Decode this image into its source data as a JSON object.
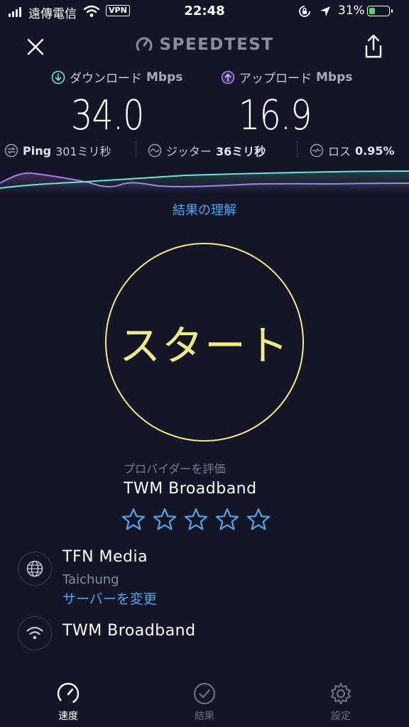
{
  "status_bar": {
    "carrier": "遠傳電信",
    "vpn": "VPN",
    "time": "22:48",
    "battery_percent": "31%",
    "battery_level": 0.31
  },
  "header": {
    "brand": "SPEEDTEST"
  },
  "speeds": {
    "download_label": "ダウンロード",
    "download_unit": "Mbps",
    "download_value": "34.0",
    "upload_label": "アップロード",
    "upload_unit": "Mbps",
    "upload_value": "16.9"
  },
  "metrics": {
    "ping_label": "Ping",
    "ping_value": "301ミリ秒",
    "jitter_label": "ジッター",
    "jitter_value": "36ミリ秒",
    "loss_label": "ロス",
    "loss_value": "0.95%"
  },
  "understand_link": "結果の理解",
  "start_label": "スタート",
  "rating": {
    "prompt": "プロバイダーを評価",
    "provider": "TWM Broadband",
    "stars_total": 5,
    "stars_filled": 0
  },
  "server": {
    "name": "TFN Media",
    "city": "Taichung",
    "change_label": "サーバーを変更"
  },
  "isp": {
    "name": "TWM Broadband"
  },
  "tabs": {
    "speed": "速度",
    "results": "結果",
    "settings": "設定"
  },
  "colors": {
    "background": "#141526",
    "download_accent": "#6fe3d2",
    "upload_accent": "#a77be8",
    "start_ring": "#f2ea8a",
    "link": "#4ea6e8",
    "star": "#4ea6e8",
    "battery": "#4cd964"
  }
}
